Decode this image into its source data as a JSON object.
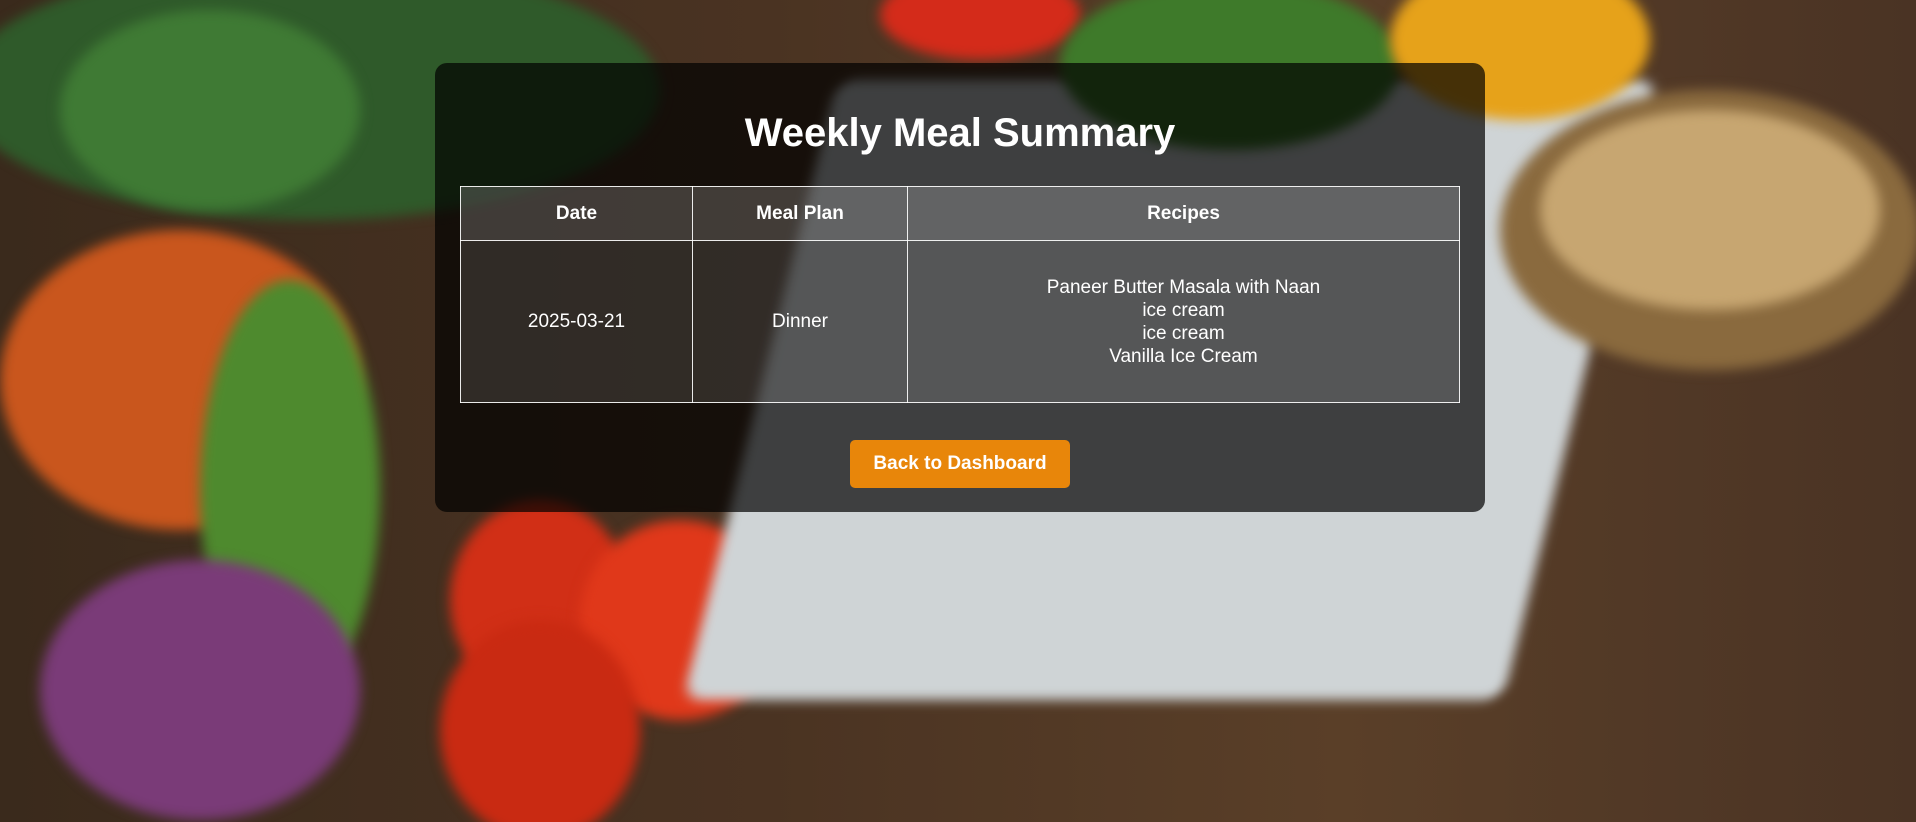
{
  "page": {
    "title": "Weekly Meal Summary",
    "accent_color": "#e8860a"
  },
  "table": {
    "headers": [
      "Date",
      "Meal Plan",
      "Recipes"
    ],
    "rows": [
      {
        "date": "2025-03-21",
        "meal_plan": "Dinner",
        "recipes": [
          "Paneer Butter Masala with Naan",
          "ice cream",
          "ice cream",
          "Vanilla Ice Cream"
        ]
      }
    ]
  },
  "actions": {
    "back_label": "Back to Dashboard"
  },
  "background": {
    "image_description_icon": "vegetables-notebook-background"
  }
}
